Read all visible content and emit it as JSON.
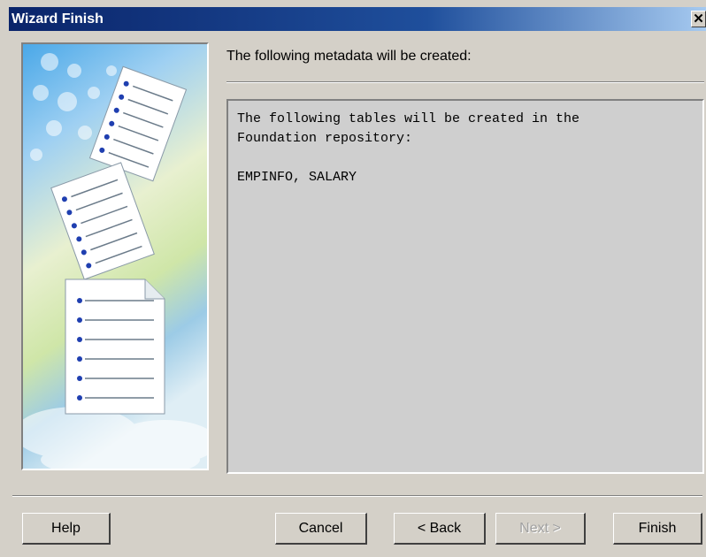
{
  "window": {
    "title": "Wizard Finish",
    "close_glyph": "✕"
  },
  "header": {
    "label": "The following metadata will be created:"
  },
  "content": {
    "line1": "The following tables will be created in the",
    "line2": "Foundation repository:",
    "line3": "EMPINFO, SALARY"
  },
  "buttons": {
    "help": "Help",
    "cancel": "Cancel",
    "back": "< Back",
    "next": "Next >",
    "finish": "Finish"
  },
  "icons": [
    "document-list-icon",
    "close-icon"
  ],
  "colors": {
    "titlebar": "#0a246a",
    "face": "#d4d0c8",
    "textbox": "#cfcfcf"
  }
}
